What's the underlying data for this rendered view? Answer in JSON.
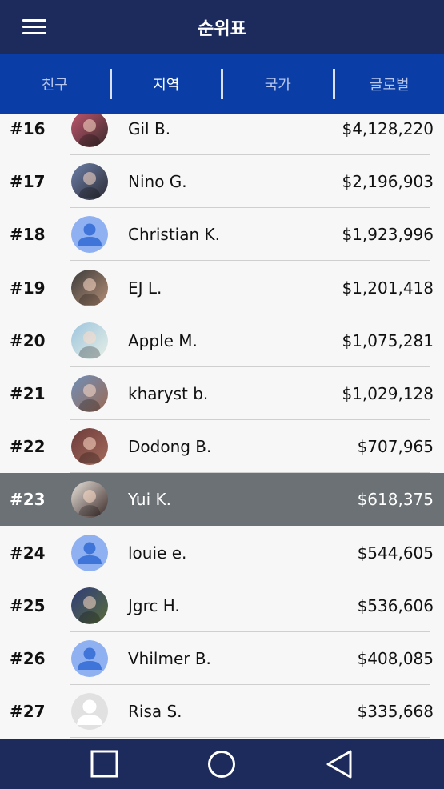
{
  "header": {
    "title": "순위표",
    "menu_icon": "hamburger-menu-icon"
  },
  "tabs": [
    {
      "label": "친구",
      "active": false
    },
    {
      "label": "지역",
      "active": true
    },
    {
      "label": "국가",
      "active": false
    },
    {
      "label": "글로벌",
      "active": false
    }
  ],
  "leaderboard": {
    "rows": [
      {
        "rank": "#16",
        "name": "Gil B.",
        "amount": "$4,128,220",
        "avatar": "photo-avatar"
      },
      {
        "rank": "#17",
        "name": "Nino G.",
        "amount": "$2,196,903",
        "avatar": "photo-avatar"
      },
      {
        "rank": "#18",
        "name": "Christian K.",
        "amount": "$1,923,996",
        "avatar": "default-user-icon"
      },
      {
        "rank": "#19",
        "name": "EJ L.",
        "amount": "$1,201,418",
        "avatar": "photo-avatar"
      },
      {
        "rank": "#20",
        "name": "Apple M.",
        "amount": "$1,075,281",
        "avatar": "photo-avatar"
      },
      {
        "rank": "#21",
        "name": "kharyst b.",
        "amount": "$1,029,128",
        "avatar": "photo-avatar"
      },
      {
        "rank": "#22",
        "name": "Dodong B.",
        "amount": "$707,965",
        "avatar": "photo-avatar"
      },
      {
        "rank": "#23",
        "name": "Yui K.",
        "amount": "$618,375",
        "avatar": "photo-avatar",
        "highlighted": true
      },
      {
        "rank": "#24",
        "name": "louie e.",
        "amount": "$544,605",
        "avatar": "default-user-icon"
      },
      {
        "rank": "#25",
        "name": "Jgrc H.",
        "amount": "$536,606",
        "avatar": "photo-avatar"
      },
      {
        "rank": "#26",
        "name": "Vhilmer B.",
        "amount": "$408,085",
        "avatar": "default-user-icon"
      },
      {
        "rank": "#27",
        "name": "Risa S.",
        "amount": "$335,668",
        "avatar": "silhouette-avatar-icon"
      }
    ]
  },
  "navbar": {
    "icons": [
      "recent-apps-icon",
      "home-icon",
      "back-icon"
    ]
  },
  "colors": {
    "header_bg": "#1c2a5c",
    "tab_bar_bg": "#0a3ea6",
    "highlight_row_bg": "#6b7175",
    "default_avatar_bg": "#8fb1f2",
    "default_avatar_fg": "#3f74d8"
  }
}
